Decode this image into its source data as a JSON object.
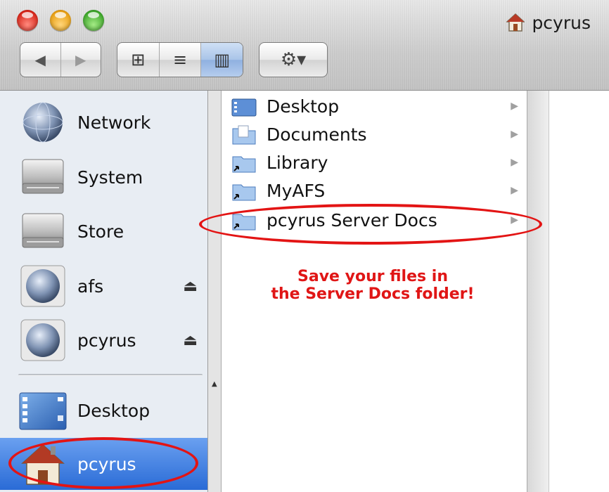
{
  "window": {
    "title": "pcyrus"
  },
  "toolbar": {
    "back_glyph": "◀",
    "forward_glyph": "▶",
    "view_icon_glyph": "⊞",
    "view_list_glyph": "≡",
    "view_column_glyph": "▥",
    "action_glyph": "⚙▾",
    "active_view": "column"
  },
  "sidebar": {
    "items": [
      {
        "label": "Network",
        "icon": "network-globe-icon"
      },
      {
        "label": "System",
        "icon": "hard-drive-icon"
      },
      {
        "label": "Store",
        "icon": "hard-drive-icon"
      },
      {
        "label": "afs",
        "icon": "server-volume-icon",
        "eject": "⏏"
      },
      {
        "label": "pcyrus",
        "icon": "server-volume-icon",
        "eject": "⏏"
      },
      {
        "label": "Desktop",
        "icon": "desktop-icon"
      },
      {
        "label": "pcyrus",
        "icon": "home-icon",
        "selected": true
      }
    ]
  },
  "column": {
    "items": [
      {
        "name": "Desktop",
        "icon": "desktop-folder-icon",
        "chevron": "▶"
      },
      {
        "name": "Documents",
        "icon": "documents-folder-icon",
        "chevron": "▶"
      },
      {
        "name": "Library",
        "icon": "alias-folder-icon",
        "chevron": "▶"
      },
      {
        "name": "MyAFS",
        "icon": "alias-folder-icon",
        "chevron": "▶"
      },
      {
        "name": "pcyrus Server Docs",
        "icon": "alias-folder-icon",
        "chevron": "▶"
      }
    ]
  },
  "annotation": {
    "line1": "Save your files in",
    "line2": "the Server Docs folder!",
    "color": "#e01616"
  },
  "colors": {
    "highlight_ring": "#e31414",
    "sidebar_selected": "#2a6bd6"
  }
}
